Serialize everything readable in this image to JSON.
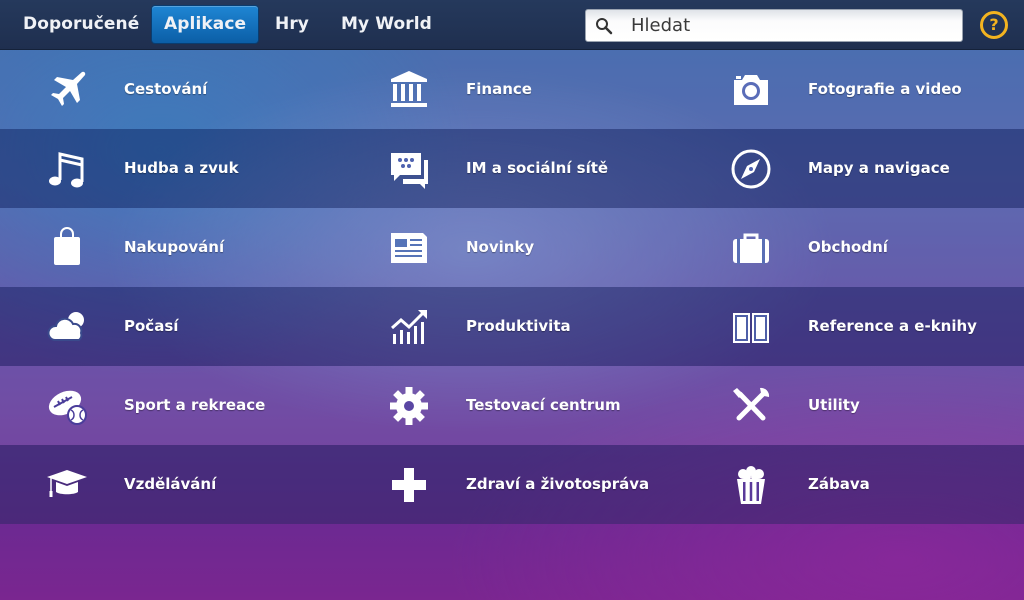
{
  "nav": {
    "tabs": [
      {
        "label": "Doporučené",
        "active": false
      },
      {
        "label": "Aplikace",
        "active": true
      },
      {
        "label": "Hry",
        "active": false
      },
      {
        "label": "My World",
        "active": false
      }
    ]
  },
  "search": {
    "placeholder": "Hledat",
    "value": "",
    "icon": "search-icon"
  },
  "help": {
    "label": "?",
    "icon": "help-icon",
    "color": "#f2b320"
  },
  "colors": {
    "accent": "#0b5ea6",
    "topbar": "#22345a",
    "help": "#f2b320"
  },
  "categories": [
    {
      "label": "Cestování",
      "icon": "airplane-icon"
    },
    {
      "label": "Finance",
      "icon": "bank-icon"
    },
    {
      "label": "Fotografie a video",
      "icon": "camera-icon"
    },
    {
      "label": "Hudba a zvuk",
      "icon": "music-note-icon"
    },
    {
      "label": "IM a sociální sítě",
      "icon": "chat-bubble-icon"
    },
    {
      "label": "Mapy a navigace",
      "icon": "compass-icon"
    },
    {
      "label": "Nakupování",
      "icon": "shopping-bag-icon"
    },
    {
      "label": "Novinky",
      "icon": "newspaper-icon"
    },
    {
      "label": "Obchodní",
      "icon": "briefcase-icon"
    },
    {
      "label": "Počasí",
      "icon": "cloud-icon"
    },
    {
      "label": "Produktivita",
      "icon": "chart-trend-icon"
    },
    {
      "label": "Reference a e-knihy",
      "icon": "open-book-icon"
    },
    {
      "label": "Sport a rekreace",
      "icon": "sports-balls-icon"
    },
    {
      "label": "Testovací centrum",
      "icon": "gear-icon"
    },
    {
      "label": "Utility",
      "icon": "tools-icon"
    },
    {
      "label": "Vzdělávání",
      "icon": "graduation-cap-icon"
    },
    {
      "label": "Zdraví a životospráva",
      "icon": "health-cross-icon"
    },
    {
      "label": "Zábava",
      "icon": "popcorn-icon"
    }
  ]
}
